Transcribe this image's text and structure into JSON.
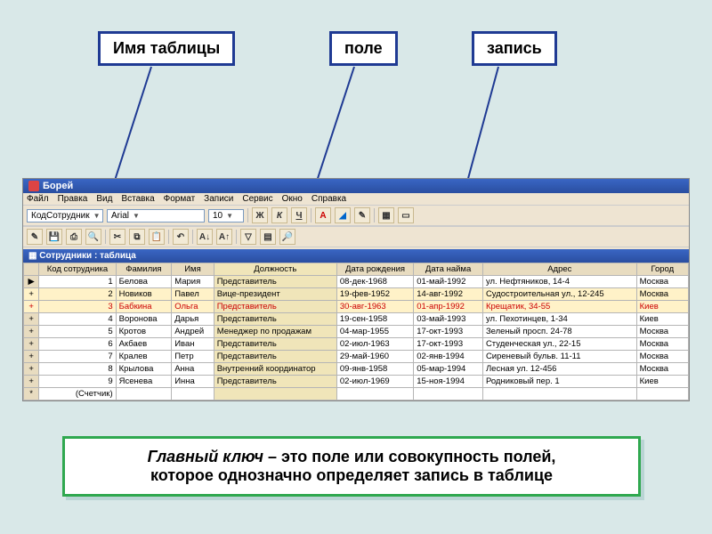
{
  "labels": {
    "table_name": "Имя таблицы",
    "field": "поле",
    "record": "запись"
  },
  "app": {
    "title": "Борей",
    "menu": [
      "Файл",
      "Правка",
      "Вид",
      "Вставка",
      "Формат",
      "Записи",
      "Сервис",
      "Окно",
      "Справка"
    ],
    "toolbar": {
      "field_combo": "КодСотрудник",
      "font_combo": "Arial",
      "size_combo": "10",
      "style": {
        "bold": "Ж",
        "italic": "К",
        "underline": "Ч"
      }
    },
    "subwindow_title": "Сотрудники : таблица",
    "columns": [
      "",
      "Код сотрудника",
      "Фамилия",
      "Имя",
      "Должность",
      "Дата рождения",
      "Дата найма",
      "Адрес",
      "Город"
    ],
    "rows": [
      {
        "sel": "▶",
        "id": "1",
        "fam": "Белова",
        "name": "Мария",
        "pos": "Представитель",
        "dob": "08-дек-1968",
        "hire": "01-май-1992",
        "addr": "ул. Нефтяников, 14-4",
        "city": "Москва"
      },
      {
        "sel": "+",
        "id": "2",
        "fam": "Новиков",
        "name": "Павел",
        "pos": "Вице-президент",
        "dob": "19-фев-1952",
        "hire": "14-авг-1992",
        "addr": "Судостроительная ул., 12-245",
        "city": "Москва"
      },
      {
        "sel": "+",
        "id": "3",
        "fam": "Бабкина",
        "name": "Ольга",
        "pos": "Представитель",
        "dob": "30-авг-1963",
        "hire": "01-апр-1992",
        "addr": "Крещатик, 34-55",
        "city": "Киев"
      },
      {
        "sel": "+",
        "id": "4",
        "fam": "Воронова",
        "name": "Дарья",
        "pos": "Представитель",
        "dob": "19-сен-1958",
        "hire": "03-май-1993",
        "addr": "ул. Пехотинцев, 1-34",
        "city": "Киев"
      },
      {
        "sel": "+",
        "id": "5",
        "fam": "Кротов",
        "name": "Андрей",
        "pos": "Менеджер по продажам",
        "dob": "04-мар-1955",
        "hire": "17-окт-1993",
        "addr": "Зеленый просп. 24-78",
        "city": "Москва"
      },
      {
        "sel": "+",
        "id": "6",
        "fam": "Акбаев",
        "name": "Иван",
        "pos": "Представитель",
        "dob": "02-июл-1963",
        "hire": "17-окт-1993",
        "addr": "Студенческая ул., 22-15",
        "city": "Москва"
      },
      {
        "sel": "+",
        "id": "7",
        "fam": "Кралев",
        "name": "Петр",
        "pos": "Представитель",
        "dob": "29-май-1960",
        "hire": "02-янв-1994",
        "addr": "Сиреневый бульв. 11-11",
        "city": "Москва"
      },
      {
        "sel": "+",
        "id": "8",
        "fam": "Крылова",
        "name": "Анна",
        "pos": "Внутренний координатор",
        "dob": "09-янв-1958",
        "hire": "05-мар-1994",
        "addr": "Лесная ул. 12-456",
        "city": "Москва"
      },
      {
        "sel": "+",
        "id": "9",
        "fam": "Ясенева",
        "name": "Инна",
        "pos": "Представитель",
        "dob": "02-июл-1969",
        "hire": "15-ноя-1994",
        "addr": "Родниковый пер. 1",
        "city": "Киев"
      },
      {
        "sel": "*",
        "id": "(Счетчик)",
        "fam": "",
        "name": "",
        "pos": "",
        "dob": "",
        "hire": "",
        "addr": "",
        "city": ""
      }
    ]
  },
  "footnote": {
    "lead": "Главный ключ",
    "dash": " – это поле или совокупность полей,",
    "line2": "которое однозначно определяет запись в таблице"
  }
}
